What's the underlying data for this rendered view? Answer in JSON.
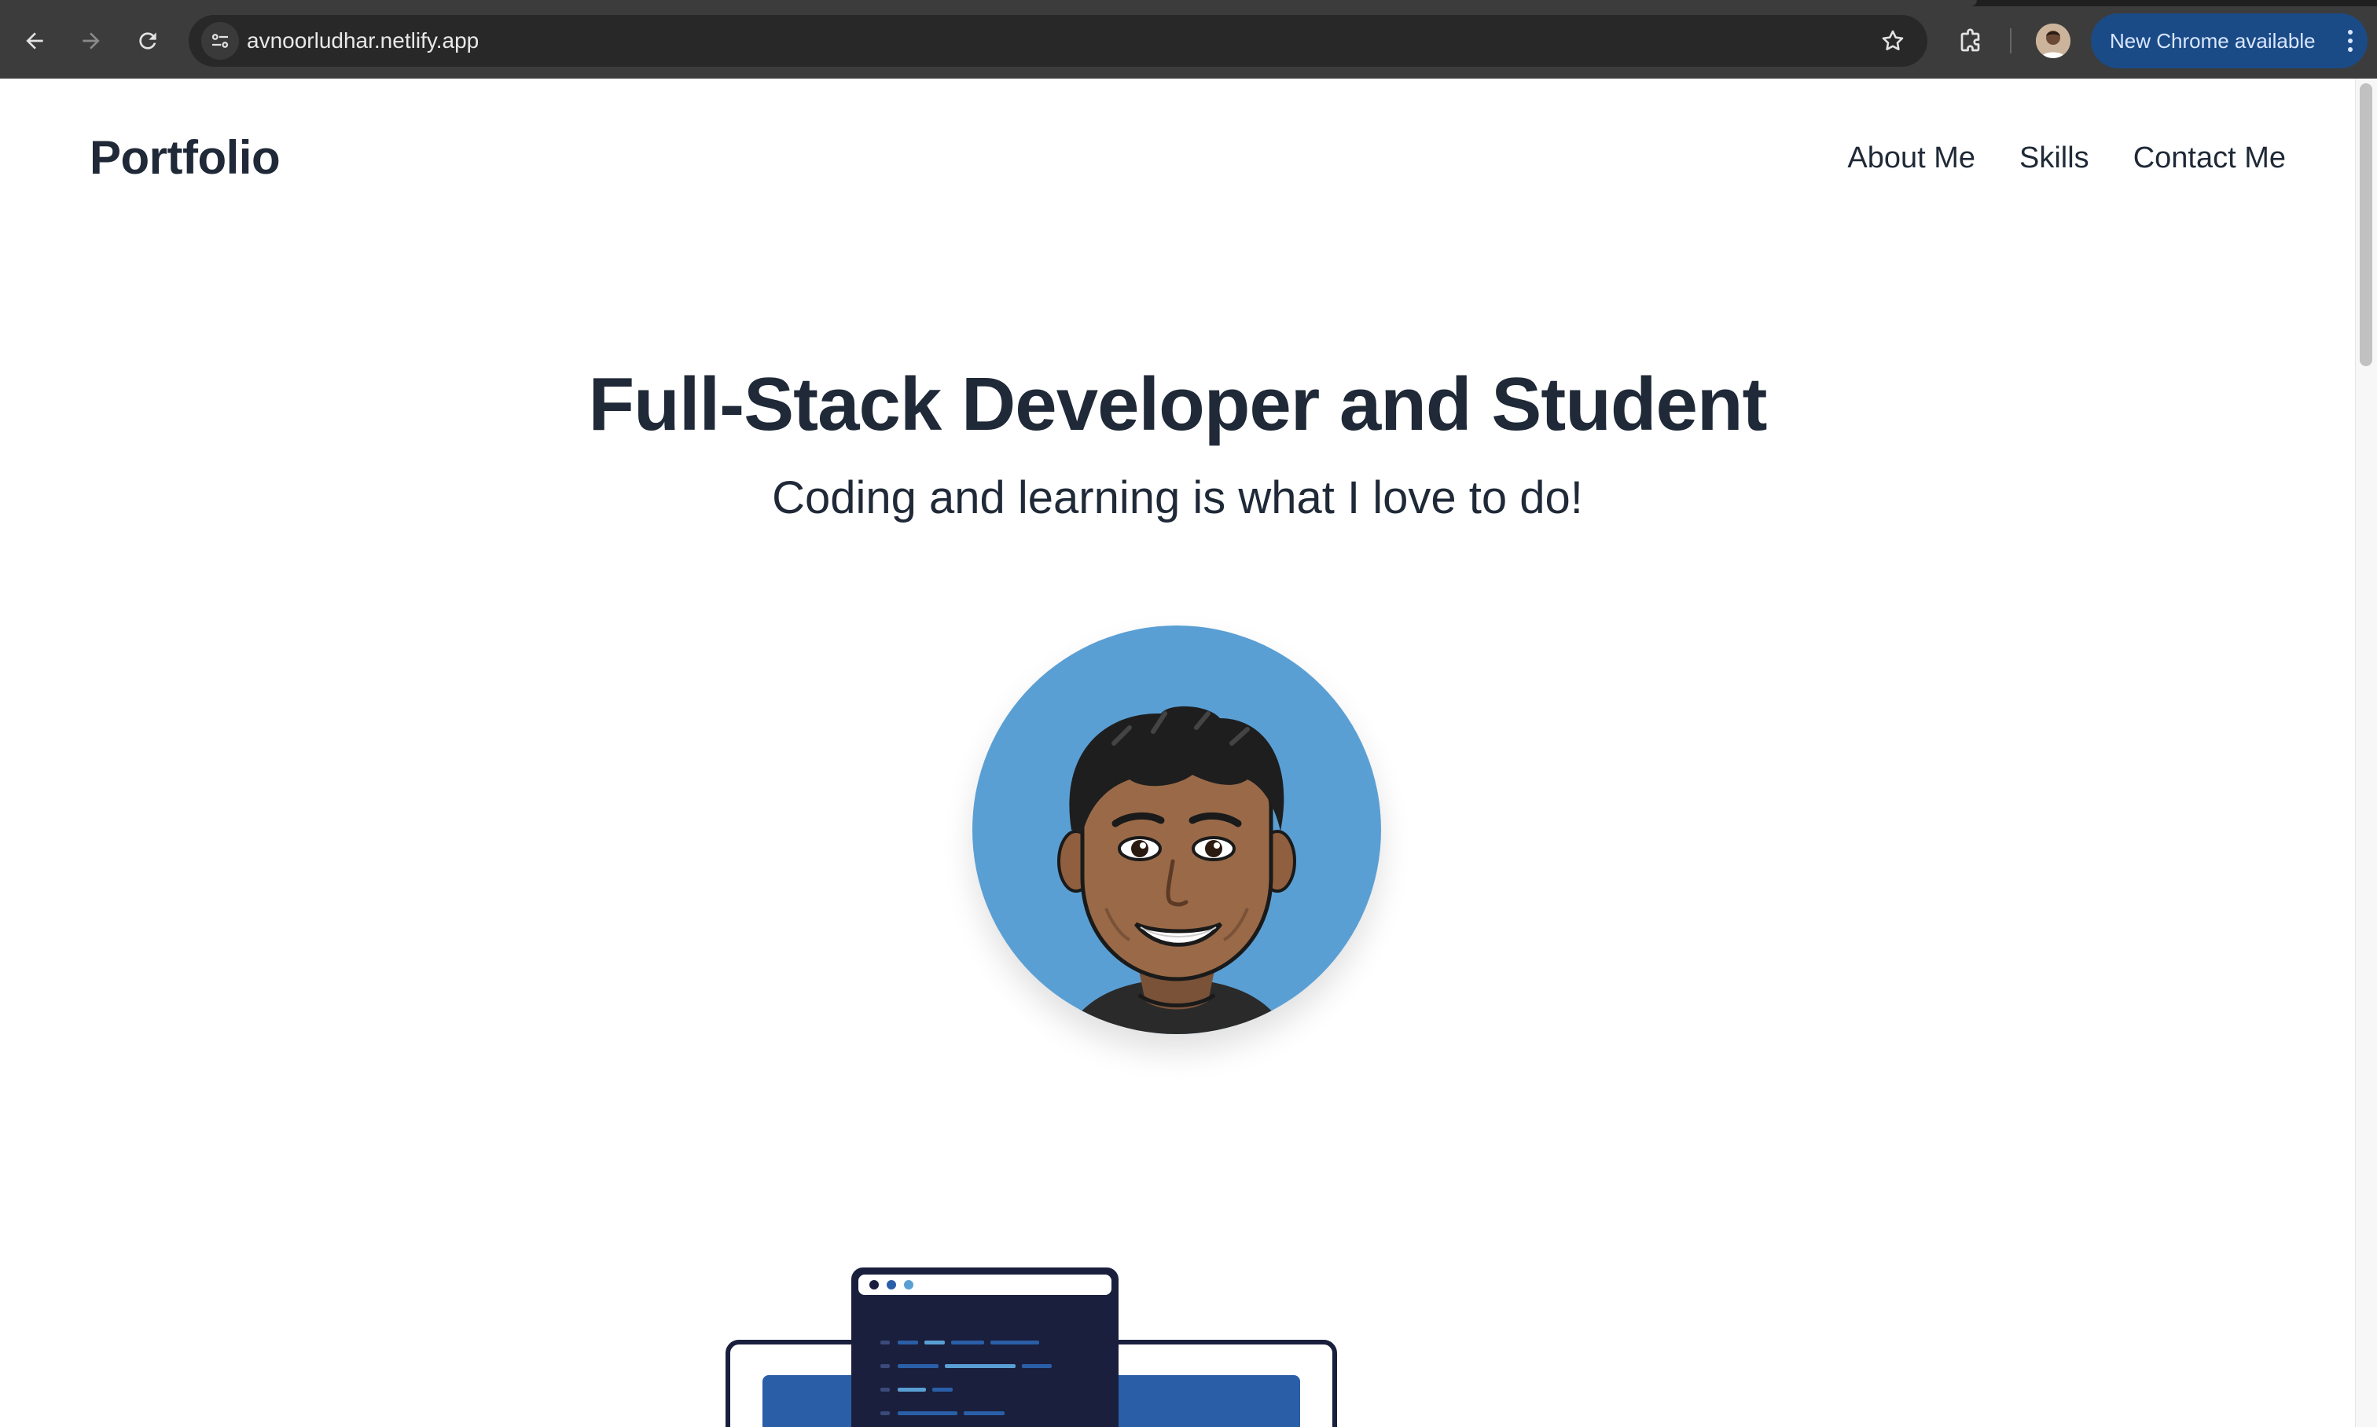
{
  "browser": {
    "url": "avnoorludhar.netlify.app",
    "update_label": "New Chrome available",
    "icons": {
      "back": "back-arrow-icon",
      "forward": "forward-arrow-icon",
      "reload": "reload-icon",
      "site_info": "site-info-icon",
      "bookmark": "star-icon",
      "extensions": "puzzle-icon",
      "menu": "kebab-menu-icon"
    },
    "colors": {
      "toolbar": "#3c3c3c",
      "omnibox": "#282828",
      "update_button": "#1a4b86"
    }
  },
  "site": {
    "brand": "Portfolio",
    "nav": [
      {
        "label": "About Me"
      },
      {
        "label": "Skills"
      },
      {
        "label": "Contact Me"
      }
    ],
    "hero": {
      "title": "Full-Stack Developer and Student",
      "subtitle": "Coding and learning is what I love to do!"
    },
    "colors": {
      "text": "#1f2937",
      "avatar_background": "#5a9fd4",
      "illustration_dark": "#1a1f3d",
      "illustration_blue": "#2a5fa8"
    }
  }
}
